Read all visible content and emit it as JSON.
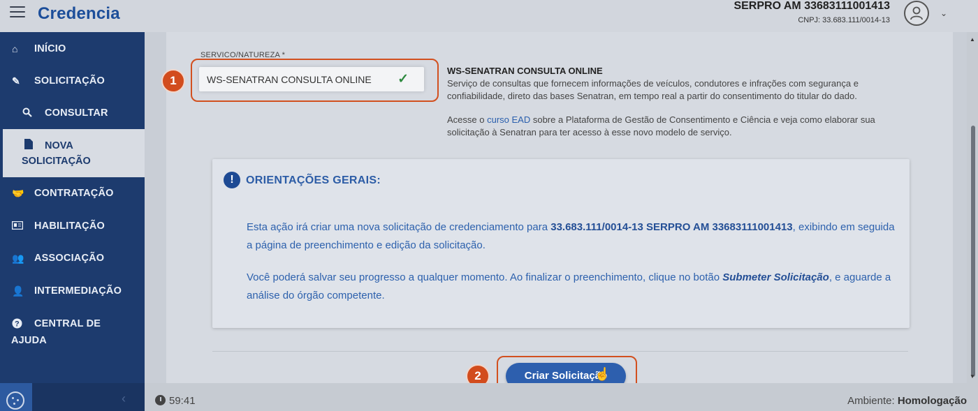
{
  "header": {
    "app_name": "Credencia",
    "org_name": "SERPRO AM 33683111001413",
    "org_cnpj": "CNPJ: 33.683.111/0014-13",
    "icons": {
      "menu": "hamburger-icon",
      "user": "user-avatar-icon",
      "caret": "chevron-down-icon"
    }
  },
  "sidebar": {
    "items": [
      {
        "label": "INÍCIO",
        "icon": "home-icon"
      },
      {
        "label": "SOLICITAÇÃO",
        "icon": "edit-document-icon"
      },
      {
        "label": "CONSULTAR",
        "icon": "search-icon"
      },
      {
        "label_line1": "NOVA",
        "label_line2": "SOLICITAÇÃO",
        "icon": "file-icon",
        "active": true
      },
      {
        "label": "CONTRATAÇÃO",
        "icon": "handshake-icon"
      },
      {
        "label": "HABILITAÇÃO",
        "icon": "id-card-icon"
      },
      {
        "label": "ASSOCIAÇÃO",
        "icon": "users-icon"
      },
      {
        "label": "INTERMEDIAÇÃO",
        "icon": "user-tie-icon"
      },
      {
        "label_line1": "CENTRAL DE",
        "label_line2": "AJUDA",
        "icon": "question-circle-icon"
      }
    ]
  },
  "form": {
    "service_label": "SERVICO/NATUREZA *",
    "service_value": "WS-SENATRAN CONSULTA ONLINE",
    "service_check": "✓"
  },
  "service_info": {
    "title": "WS-SENATRAN CONSULTA ONLINE",
    "description": "Serviço de consultas que fornecem informações de veículos, condutores e infrações com segurança e confiabilidade, direto das bases Senatran, em tempo real a partir do consentimento do titular do dado.",
    "ead_before": "Acesse o ",
    "ead_link": "curso EAD",
    "ead_after": " sobre a Plataforma de Gestão de Consentimento e Ciência e veja como elaborar sua solicitação à Senatran para ter acesso à esse novo modelo de serviço."
  },
  "guidelines": {
    "title": "ORIENTAÇÕES GERAIS:",
    "p1_before": "Esta ação irá criar uma nova solicitação de credenciamento para ",
    "p1_bold": "33.683.111/0014-13 SERPRO AM 33683111001413",
    "p1_after": ", exibindo em seguida a página de preenchimento e edição da solicitação.",
    "p2_before": "Você poderá salvar seu progresso a qualquer momento. Ao finalizar o preenchimento, clique no botão ",
    "p2_bold": "Submeter Solicitação",
    "p2_after": ", e aguarde a análise do órgão competente."
  },
  "actions": {
    "create_label": "Criar Solicitação"
  },
  "annotations": {
    "step1": "1",
    "step2": "2"
  },
  "footer": {
    "timer": "59:41",
    "env_label": "Ambiente: ",
    "env_value": "Homologação"
  },
  "colors": {
    "primary": "#1d3b6e",
    "brand": "#1c4e9a",
    "accent_annotation": "#d24c1d",
    "button": "#2d5fae"
  }
}
